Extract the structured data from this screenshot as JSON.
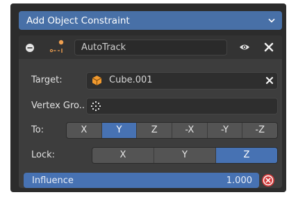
{
  "add_constraint": {
    "label": "Add Object Constraint"
  },
  "constraint": {
    "name": "AutoTrack",
    "icons": {
      "collapse": "minus-circle-icon",
      "type": "track-constraint-icon",
      "visibility": "eye-icon",
      "delete": "close-icon"
    }
  },
  "target": {
    "label": "Target:",
    "value": "Cube.001",
    "icon": "cube-object-icon"
  },
  "vertex_group": {
    "label": "Vertex Gro..",
    "value": "",
    "icon": "vertex-group-icon"
  },
  "to": {
    "label": "To:",
    "options": [
      "X",
      "Y",
      "Z",
      "-X",
      "-Y",
      "-Z"
    ],
    "selected": "Y"
  },
  "lock": {
    "label": "Lock:",
    "options": [
      "X",
      "Y",
      "Z"
    ],
    "selected": "Z"
  },
  "influence": {
    "label": "Influence",
    "value": "1.000"
  },
  "colors": {
    "accent": "#4772b3",
    "panel": "#3d3d3d",
    "header": "#333333",
    "delete_red": "#d23a3a"
  }
}
